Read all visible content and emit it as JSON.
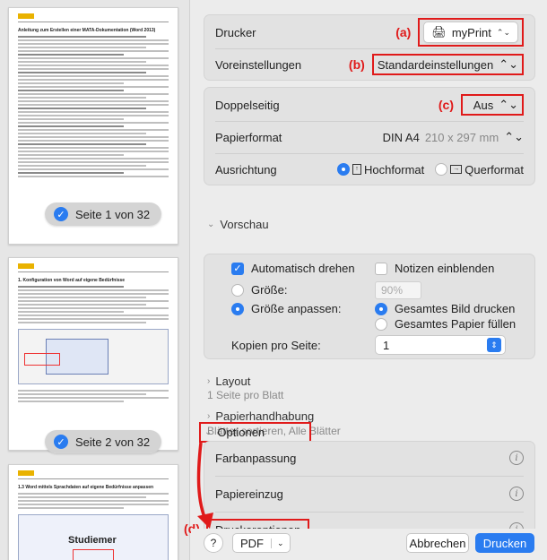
{
  "preview_pages": [
    {
      "label": "Seite 1 von 32",
      "title": "Anleitung zum Erstellen einer MATA-Dokumentation (Word 2013)"
    },
    {
      "label": "Seite 2 von 32",
      "title": "1. Konfiguration von Word auf eigene Bedürfnisse"
    },
    {
      "title": "1.3 Word mittels Sprachdaten auf eigene Bedürfnisse anpassen",
      "image_text": "Studiemer"
    }
  ],
  "printer": {
    "label": "Drucker",
    "value": "myPrint",
    "annotation": "(a)"
  },
  "presets": {
    "label": "Voreinstellungen",
    "value": "Standardeinstellungen",
    "annotation": "(b)"
  },
  "duplex": {
    "label": "Doppelseitig",
    "value": "Aus",
    "annotation": "(c)"
  },
  "paper": {
    "label": "Papierformat",
    "value": "DIN A4",
    "dims": "210 x 297 mm"
  },
  "orientation": {
    "label": "Ausrichtung",
    "portrait": "Hochformat",
    "landscape": "Querformat",
    "selected": "Hochformat"
  },
  "preview": {
    "title": "Vorschau",
    "auto_rotate": "Automatisch drehen",
    "auto_rotate_checked": true,
    "show_notes": "Notizen einblenden",
    "show_notes_checked": false,
    "size": "Größe:",
    "size_value": "90%",
    "fit": "Größe anpassen:",
    "print_entire": "Gesamtes Bild drucken",
    "fill_paper": "Gesamtes Papier füllen",
    "copies_per_page": "Kopien pro Seite:",
    "copies_value": "1"
  },
  "layout": {
    "title": "Layout",
    "sub": "1 Seite pro Blatt"
  },
  "paper_handling": {
    "title": "Papierhandhabung",
    "sub": "Blätter sortieren, Alle Blätter"
  },
  "options": {
    "title": "Optionen",
    "items": [
      "Farbanpassung",
      "Papiereinzug",
      "Druckeroptionen"
    ],
    "annotation": "(d)"
  },
  "footer": {
    "help": "?",
    "pdf": "PDF",
    "cancel": "Abbrechen",
    "print": "Drucken"
  },
  "colors": {
    "accent": "#2a7cf0",
    "annotation_red": "#e01a1a"
  }
}
